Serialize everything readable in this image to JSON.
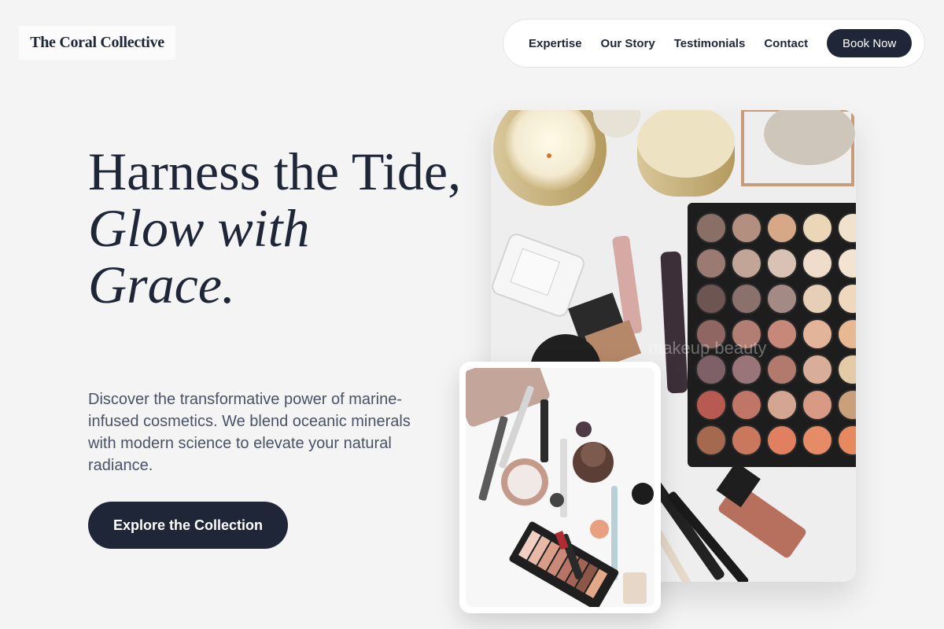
{
  "brand": {
    "name": "The Coral Collective"
  },
  "nav": {
    "links": [
      "Expertise",
      "Our Story",
      "Testimonials",
      "Contact"
    ],
    "cta_label": "Book Now"
  },
  "hero": {
    "title_line1": "Harness the Tide,",
    "title_line2": "Glow with Grace.",
    "description": "Discover the transformative power of marine-infused cosmetics. We blend oceanic minerals with modern science to elevate your natural radiance.",
    "cta_label": "Explore the Collection"
  },
  "images": {
    "main_watermark": "makeup beauty"
  },
  "palette": {
    "navy": "#1e2638",
    "background": "#f4f4f5",
    "text_muted": "#4a5266"
  }
}
